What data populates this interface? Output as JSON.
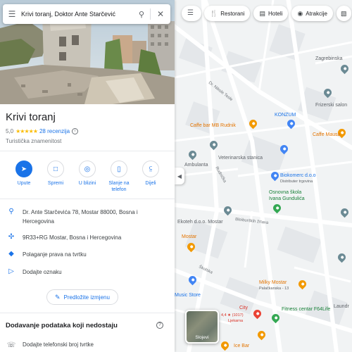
{
  "search": {
    "query": "Krivi toranj, Doktor Ante Starčević",
    "menu_icon": "menu-icon",
    "search_icon": "search-icon",
    "clear_icon": "close-icon"
  },
  "place": {
    "name": "Krivi toranj",
    "rating": "5,0",
    "stars": "★★★★★",
    "reviews": "28 recenzija",
    "category": "Turistička znamenitost"
  },
  "actions": [
    {
      "label": "Upute",
      "icon": "directions-icon"
    },
    {
      "label": "Spremi",
      "icon": "bookmark-icon"
    },
    {
      "label": "U blizini",
      "icon": "nearby-icon"
    },
    {
      "label": "Slanje na telefon",
      "icon": "send-to-phone-icon"
    },
    {
      "label": "Dijeli",
      "icon": "share-icon"
    }
  ],
  "info": {
    "address": "Dr. Ante Starčevića 78, Mostar 88000, Bosna i Hercegovina",
    "plus_code": "9R33+RG Mostar, Bosna i Hercegovina",
    "claim": "Polaganje prava na tvrtku",
    "label": "Dodajte oznaku"
  },
  "suggest_edit": "Predložite izmjenu",
  "missing": {
    "title": "Dodavanje podataka koji nedostaju",
    "phone": "Dodajte telefonski broj tvrtke"
  },
  "map": {
    "chips": [
      {
        "label": "Restorani",
        "icon": "fork-knife-icon"
      },
      {
        "label": "Hoteli",
        "icon": "bed-icon"
      },
      {
        "label": "Atrakcije",
        "icon": "camera-icon"
      }
    ],
    "layers_label": "Slojevi",
    "labels": {
      "zagrebinska": "Zagrebinska",
      "frizerski": "Frizerski salon",
      "nikole_tesle": "Dr. Nikole Tesle",
      "konzum": "KONZUM",
      "caffe_rudnik": "Caffe bar MB Rudnik",
      "caffe_mausa": "Caffe Mausa",
      "veterinarska": "Veterinarska stanica",
      "ambulanta": "Ambulanta",
      "biokomerc": "Biokomerc d.o.o",
      "biokomerc_sub": "Distributer trgovina",
      "skola": "Osnovna škola",
      "skola2": "Ivana Gundulića",
      "bleiburska": "Bleiburških žrtava",
      "ekoteh": "Ekoteh d.o.o. Mostar",
      "bostar": "Mostar",
      "milky": "Milky Mostar",
      "palackanska": "Palačkanska - 13",
      "music": "Music Store",
      "city": "City",
      "city_rating": "4,4 ★ (1017)",
      "city_sub": "Ljekarna",
      "fitness": "Fitness centar F64Life",
      "ice": "Ice Bar",
      "laundry": "Laundr",
      "rudnicka": "Rudnička",
      "skolska": "Školska"
    }
  },
  "colors": {
    "accent": "#1a73e8",
    "star": "#fbbc04",
    "poi_orange": "#f29900",
    "map_bg": "#f1f3f4"
  }
}
